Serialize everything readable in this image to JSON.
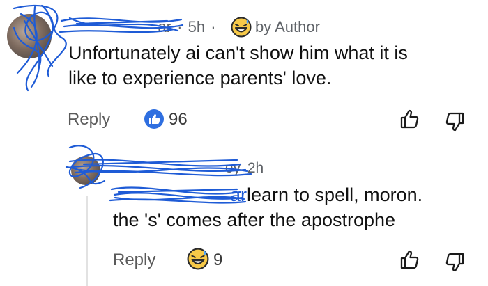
{
  "comments": [
    {
      "author_suffix": "ar",
      "time": "5h",
      "separator": "·",
      "liked_by": "by Author",
      "text_line1": "Unfortunately ai can't show him what it is",
      "text_line2": "like to experience parents' love.",
      "reply_label": "Reply",
      "reaction_icon": "thumbs-up-badge-icon",
      "reaction_count": "96"
    },
    {
      "author_suffix": "ey",
      "time": "2h",
      "mention_suffix": "ar",
      "text_line1_rest": "learn to spell, moron.",
      "text_line2": "the 's' comes after the apostrophe",
      "reply_label": "Reply",
      "reaction_icon": "grinning-sweat-emoji-icon",
      "reaction_count": "9"
    }
  ],
  "colors": {
    "scribble": "#1e5bd6",
    "reaction_blue": "#2f6fe0",
    "emoji_yellow": "#f7c948"
  }
}
